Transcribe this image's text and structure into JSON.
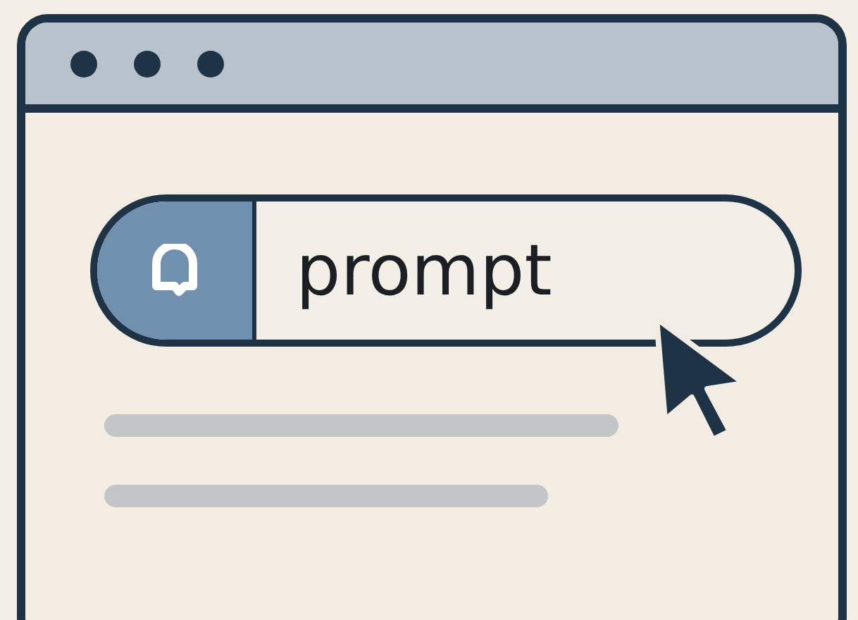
{
  "search": {
    "value": "prompt"
  }
}
